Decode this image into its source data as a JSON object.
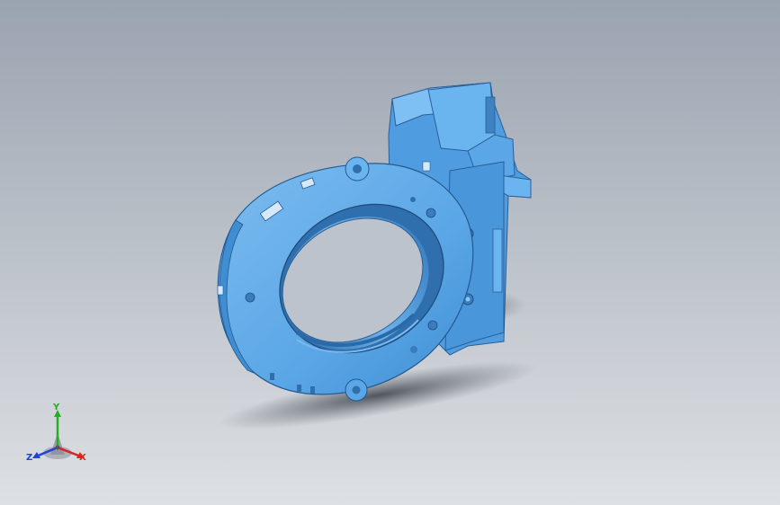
{
  "viewport": {
    "background_top": "#9aa3b0",
    "background_bottom": "#dde0e4",
    "model_color": "#5aa6e6",
    "model_dark": "#2f6fae",
    "model_light": "#8cc6f4"
  },
  "triad": {
    "x_label": "X",
    "y_label": "Y",
    "z_label": "Z",
    "x_color": "#e02020",
    "y_color": "#20b020",
    "z_color": "#2040e0"
  }
}
